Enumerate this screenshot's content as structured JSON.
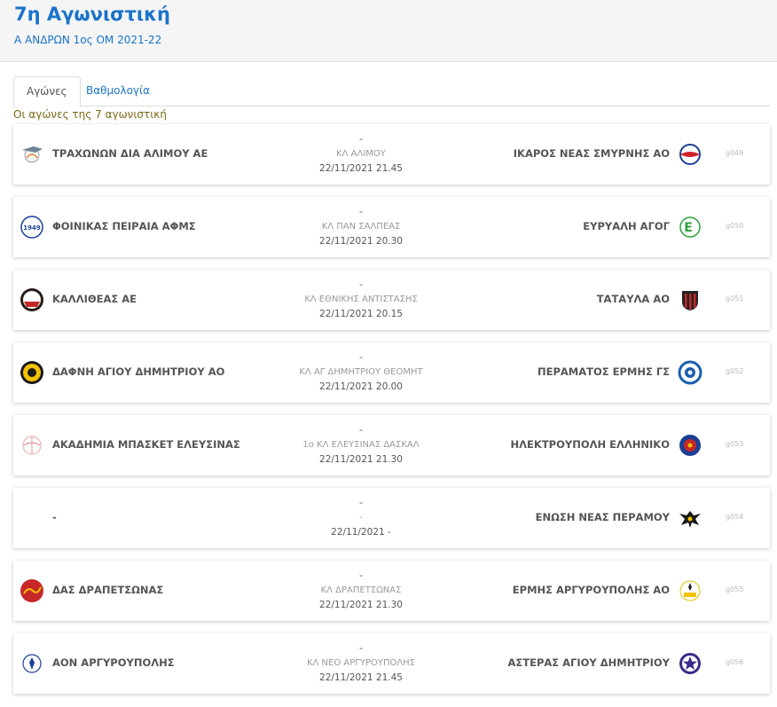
{
  "header": {
    "title": "7η Αγωνιστική",
    "subtitle": "Α ΑΝΔΡΩΝ 1ος ΟΜ 2021-22"
  },
  "tabs": [
    {
      "label": "Αγώνες",
      "active": true
    },
    {
      "label": "Βαθμολογία",
      "active": false
    }
  ],
  "caption": "Οι αγώνες της 7 αγωνιστική",
  "colors": {
    "accent": "#1a73c9",
    "caption": "#7a6a1a"
  },
  "matches": [
    {
      "home": "ΤΡΑΧΩΝΩΝ ΔΙΑ ΑΛΙΜΟΥ ΑΕ",
      "away": "ΙΚΑΡΟΣ ΝΕΑΣ ΣΜΥΡΝΗΣ ΑΟ",
      "score": "-",
      "venue": "ΚΛ ΑΛΙΜΟΥ",
      "datetime": "22/11/2021 21.45",
      "code": "g049",
      "home_logo": "basketball-bird-icon",
      "away_logo": "red-blue-ball-icon"
    },
    {
      "home": "ΦΟΙΝΙΚΑΣ ΠΕΙΡΑΙΑ ΑΦΜΣ",
      "away": "ΕΥΡΥΑΛΗ ΑΓΟΓ",
      "score": "-",
      "venue": "ΚΛ ΠΑΝ ΣΑΛΠΕΑΣ",
      "datetime": "22/11/2021 20.30",
      "code": "g050",
      "home_logo": "phoenix-1949-icon",
      "away_logo": "green-e-icon"
    },
    {
      "home": "ΚΑΛΛΙΘΕΑΣ ΑΕ",
      "away": "ΤΑΤΑΥΛΑ ΑΟ",
      "score": "-",
      "venue": "ΚΛ ΕΘΝΙΚΗΣ ΑΝΤΙΣΤΑΣΗΣ",
      "datetime": "22/11/2021 20.15",
      "code": "g051",
      "home_logo": "kallithea-crest-icon",
      "away_logo": "striped-shield-icon"
    },
    {
      "home": "ΔΑΦΝΗ ΑΓΙΟΥ ΔΗΜΗΤΡΙΟΥ ΑΟ",
      "away": "ΠΕΡΑΜΑΤΟΣ ΕΡΜΗΣ ΓΣ",
      "score": "-",
      "venue": "ΚΛ ΑΓ ΔΗΜΗΤΡΙΟΥ ΘΕΟΜΗΤ",
      "datetime": "22/11/2021 20.00",
      "code": "g052",
      "home_logo": "yellow-black-crest-icon",
      "away_logo": "blue-ring-icon"
    },
    {
      "home": "ΑΚΑΔΗΜΙΑ ΜΠΑΣΚΕΤ ΕΛΕΥΣΙΝΑΣ",
      "away": "ΗΛΕΚΤΡΟΥΠΟΛΗ ΕΛΛΗΝΙΚΟ",
      "score": "-",
      "venue": "1ο ΚΛ ΕΛΕΥΣΙΝΑΣ ΔΑΣΚΑΛ",
      "datetime": "22/11/2021 21.30",
      "code": "g053",
      "home_logo": "academy-ball-icon",
      "away_logo": "blue-red-crest-icon"
    },
    {
      "home": "-",
      "away": "ΕΝΩΣΗ ΝΕΑΣ ΠΕΡΑΜΟΥ",
      "score": "-",
      "venue": "-",
      "datetime": "22/11/2021 -",
      "code": "g054",
      "home_logo": "",
      "away_logo": "double-eagle-icon"
    },
    {
      "home": "ΔΑΣ ΔΡΑΠΕΤΣΩΝΑΣ",
      "away": "ΕΡΜΗΣ ΑΡΓΥΡΟΥΠΟΛΗΣ ΑΟ",
      "score": "-",
      "venue": "ΚΛ ΔΡΑΠΕΤΣΩΝΑΣ",
      "datetime": "22/11/2021 21.30",
      "code": "g055",
      "home_logo": "red-wave-icon",
      "away_logo": "hermes-figure-icon"
    },
    {
      "home": "ΑΟΝ ΑΡΓΥΡΟΥΠΟΛΗΣ",
      "away": "ΑΣΤΕΡΑΣ ΑΓΙΟΥ ΔΗΜΗΤΡΙΟΥ",
      "score": "-",
      "venue": "ΚΛ ΝΕΟ ΑΡΓΥΡΟΥΠΟΛΗΣ",
      "datetime": "22/11/2021 21.45",
      "code": "g056",
      "home_logo": "laurel-figure-icon",
      "away_logo": "purple-star-icon"
    }
  ]
}
